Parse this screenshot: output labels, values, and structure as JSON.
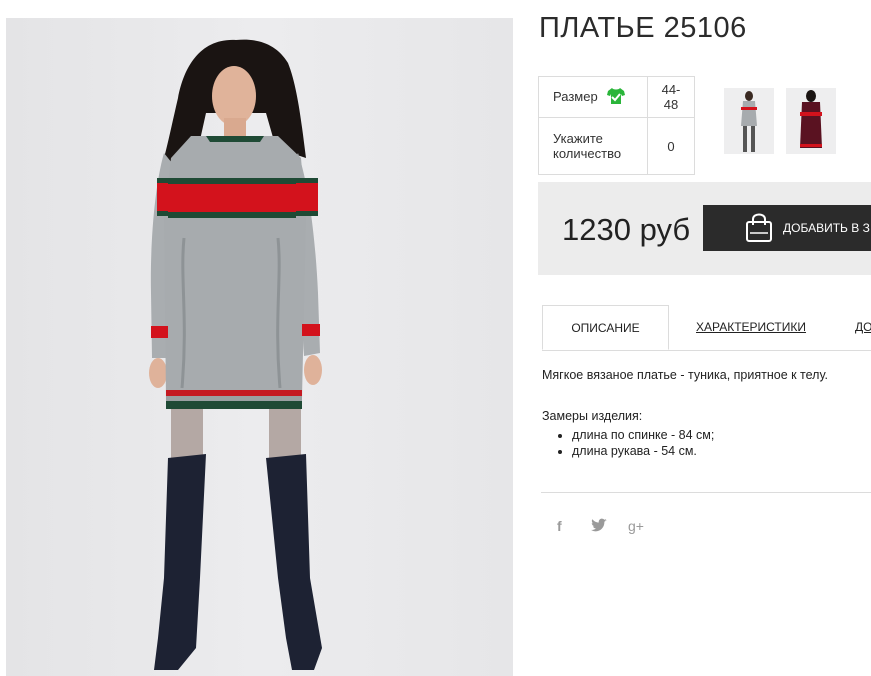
{
  "product": {
    "title": "ПЛАТЬЕ 25106",
    "price": "1230 руб",
    "add_to_cart_label": "ДОБАВИТЬ В З"
  },
  "options": {
    "size_label": "Размер",
    "size_value": "44-48",
    "qty_label_1": "Укажите",
    "qty_label_2": "количество",
    "qty_value": "0"
  },
  "tabs": [
    "ОПИСАНИЕ",
    "ХАРАКТЕРИСТИКИ",
    "ДО"
  ],
  "description": {
    "intro": "Мягкое вязаное платье - туника, приятное к телу.",
    "measurements_title": "Замеры изделия:",
    "items": [
      "длина по спинке - 84 см;",
      "длина рукава - 54 см."
    ]
  },
  "social": {
    "facebook": "f",
    "googleplus": "g+"
  },
  "icons": [
    "shirt-size-icon",
    "shopping-bag-icon",
    "facebook-icon",
    "twitter-icon",
    "google-plus-icon"
  ],
  "colors": {
    "size_icon": "#2ab53a",
    "button_bg": "#2b2b2b",
    "price_bg": "#ececec",
    "dress_gray": "#a7abae",
    "stripe_red": "#d3121c",
    "stripe_green": "#1f4a35",
    "boots": "#1d2233"
  }
}
